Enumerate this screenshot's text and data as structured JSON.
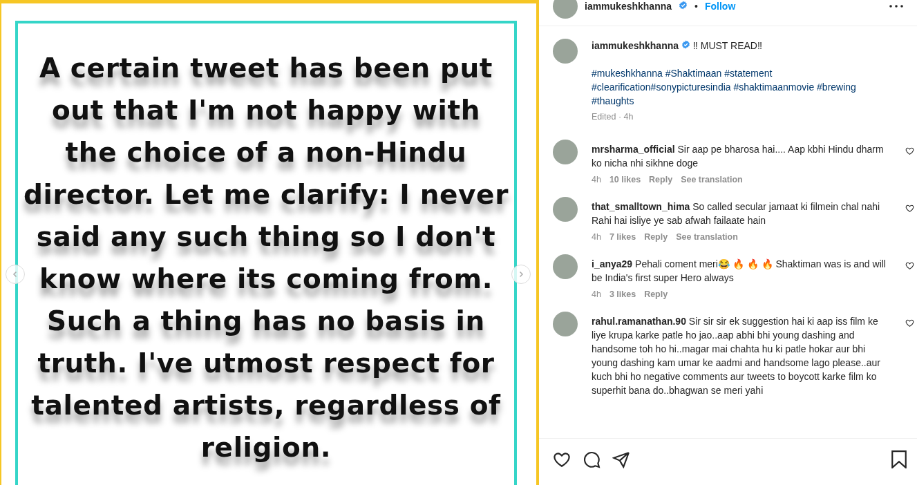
{
  "post_image": {
    "text": "A certain tweet has been put out that I'm not happy with the choice of a non-Hindu director. Let me clarify: I never said any such thing so I don't know where its coming from. Such a thing has no basis in truth. I've utmost respect for talented artists, regardless of religion."
  },
  "header": {
    "username": "iammukeshkhanna",
    "verified": true,
    "separator": "•",
    "follow": "Follow"
  },
  "caption": {
    "username": "iammukeshkhanna",
    "verified": true,
    "text": "‼ MUST READ‼",
    "hashtags": "#mukeshkhanna #Shaktimaan #statement #clearification#sonypicturesindia #shaktimaanmovie #brewing #thaughts",
    "meta": "Edited · 4h"
  },
  "comments": [
    {
      "username": "mrsharma_official",
      "text": "Sir aap pe bharosa hai.... Aap kbhi Hindu dharm ko nicha nhi sikhne doge",
      "time": "4h",
      "likes": "10 likes",
      "actions": [
        "Reply",
        "See translation"
      ]
    },
    {
      "username": "that_smalltown_hima",
      "text": "So called secular jamaat ki filmein chal nahi Rahi hai isliye ye sab afwah failaate hain",
      "time": "4h",
      "likes": "7 likes",
      "actions": [
        "Reply",
        "See translation"
      ]
    },
    {
      "username": "i_anya29",
      "text": "Pehali coment meri😂  🔥 🔥 🔥  Shaktiman was is and will be India's first super Hero always",
      "time": "4h",
      "likes": "3 likes",
      "actions": [
        "Reply"
      ]
    },
    {
      "username": "rahul.ramanathan.90",
      "text": "Sir sir sir ek suggestion hai ki aap iss film ke liye krupa karke patle ho jao..aap abhi bhi young dashing and handsome toh ho hi..magar mai chahta hu ki patle hokar aur bhi young dashing kam umar ke aadmi and handsome lago please..aur kuch bhi ho negative comments aur tweets to boycott karke film ko superhit bana do..bhagwan se meri yahi"
    }
  ]
}
